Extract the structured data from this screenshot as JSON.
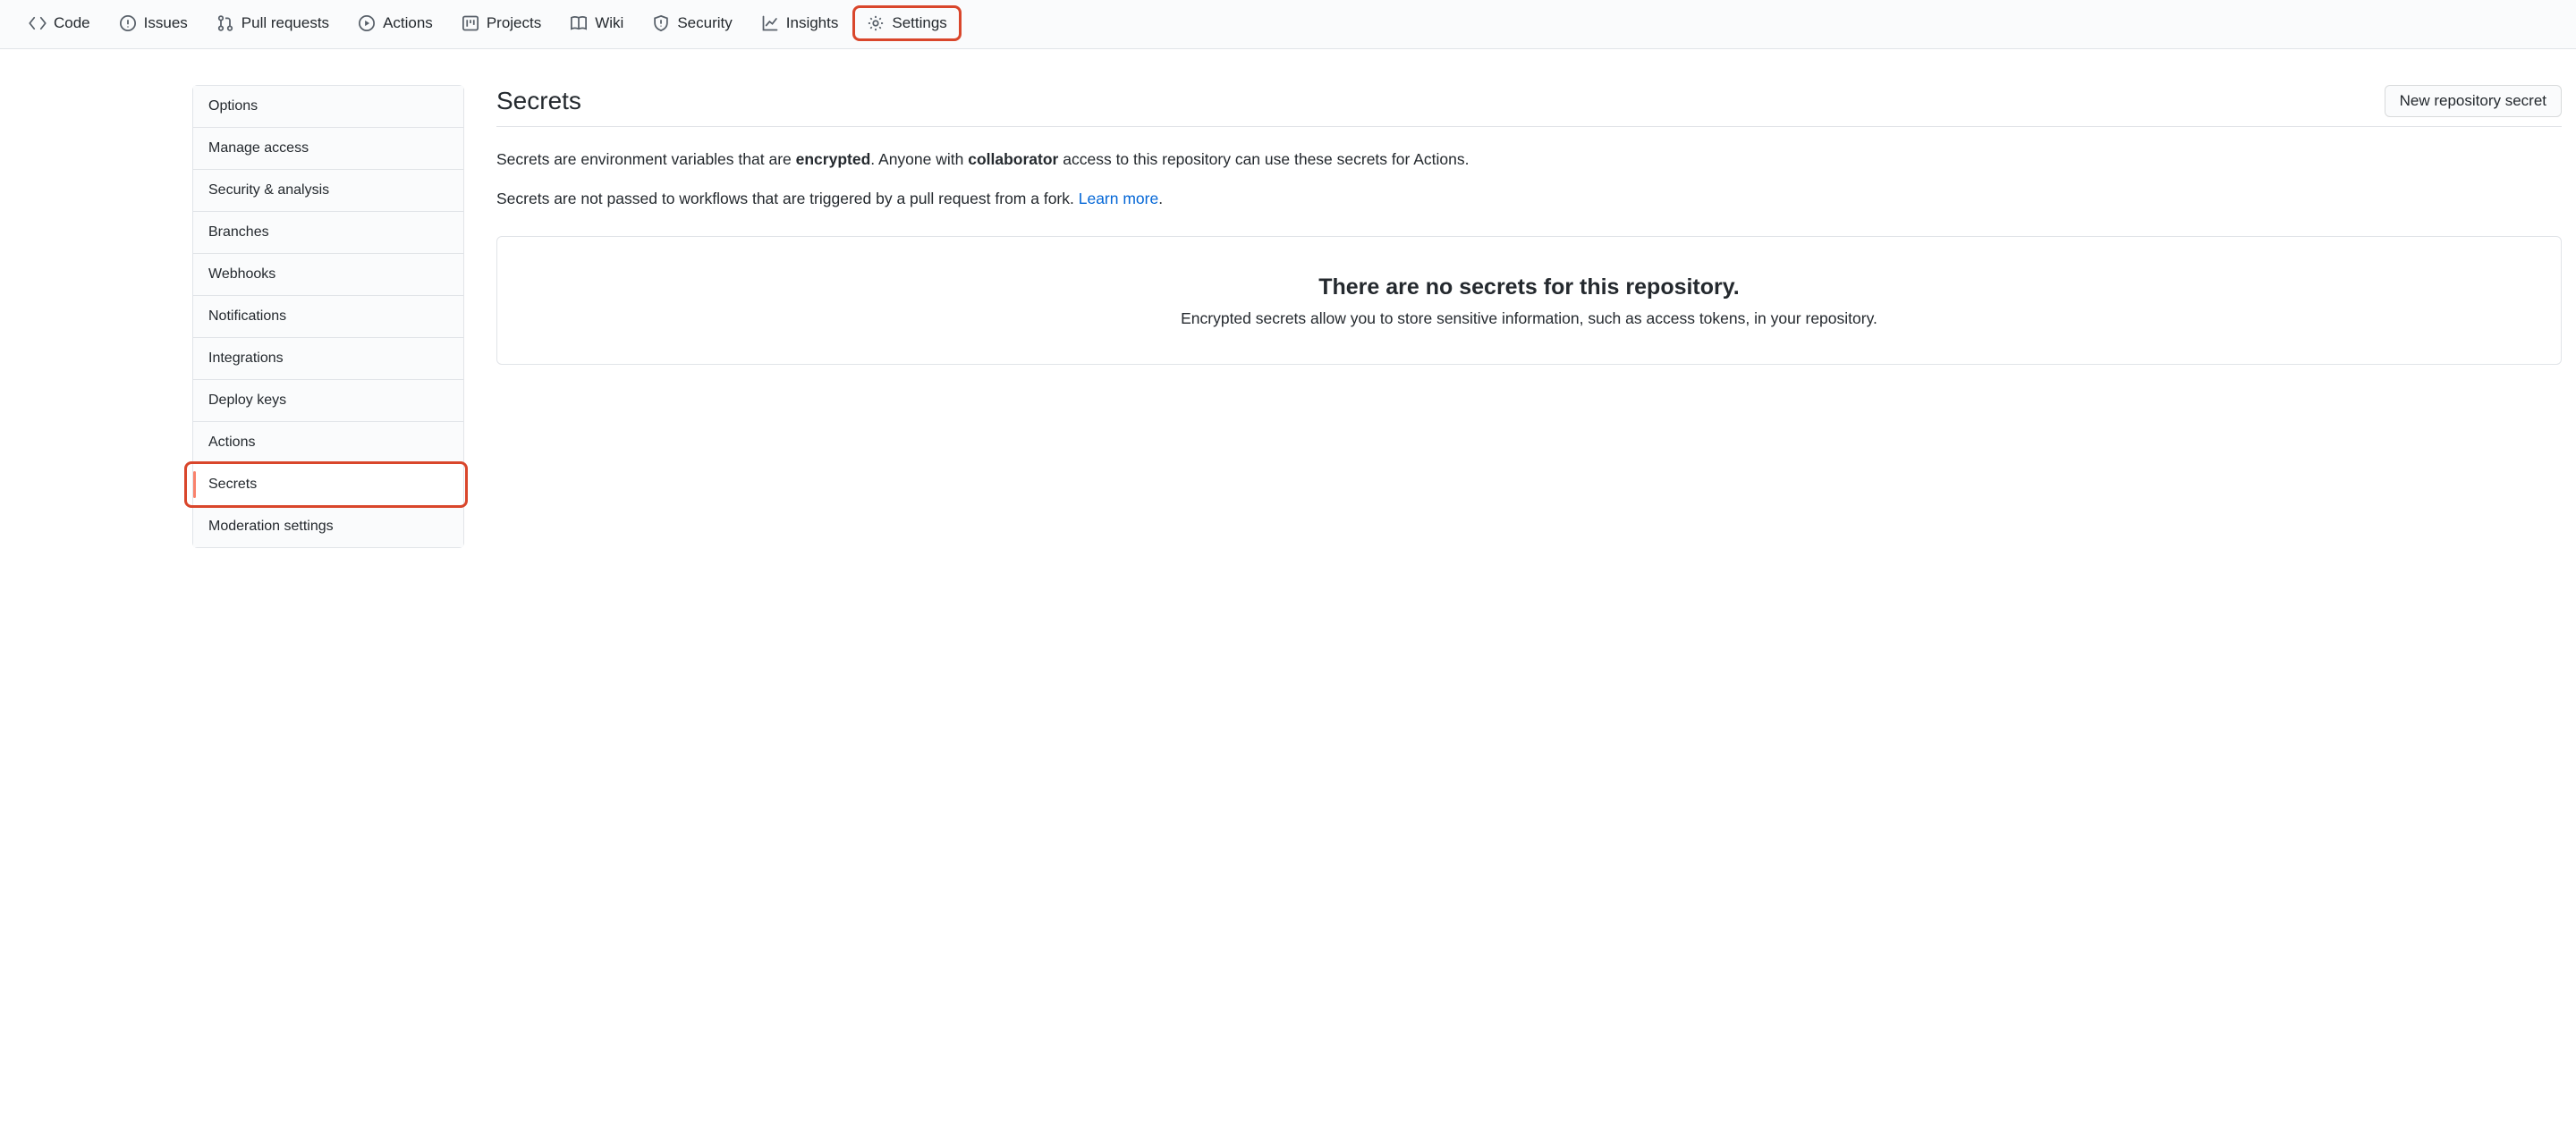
{
  "nav": {
    "items": [
      {
        "label": "Code",
        "icon": "code"
      },
      {
        "label": "Issues",
        "icon": "issue"
      },
      {
        "label": "Pull requests",
        "icon": "pr"
      },
      {
        "label": "Actions",
        "icon": "play"
      },
      {
        "label": "Projects",
        "icon": "project"
      },
      {
        "label": "Wiki",
        "icon": "book"
      },
      {
        "label": "Security",
        "icon": "shield"
      },
      {
        "label": "Insights",
        "icon": "graph"
      },
      {
        "label": "Settings",
        "icon": "gear"
      }
    ]
  },
  "sidebar": {
    "items": [
      {
        "label": "Options"
      },
      {
        "label": "Manage access"
      },
      {
        "label": "Security & analysis"
      },
      {
        "label": "Branches"
      },
      {
        "label": "Webhooks"
      },
      {
        "label": "Notifications"
      },
      {
        "label": "Integrations"
      },
      {
        "label": "Deploy keys"
      },
      {
        "label": "Actions"
      },
      {
        "label": "Secrets"
      },
      {
        "label": "Moderation settings"
      }
    ]
  },
  "main": {
    "title": "Secrets",
    "new_button": "New repository secret",
    "desc1_pre": "Secrets are environment variables that are ",
    "desc1_b1": "encrypted",
    "desc1_mid": ". Anyone with ",
    "desc1_b2": "collaborator",
    "desc1_post": " access to this repository can use these secrets for Actions.",
    "desc2_pre": "Secrets are not passed to workflows that are triggered by a pull request from a fork. ",
    "desc2_link": "Learn more",
    "desc2_post": ".",
    "empty_title": "There are no secrets for this repository.",
    "empty_desc": "Encrypted secrets allow you to store sensitive information, such as access tokens, in your repository."
  }
}
